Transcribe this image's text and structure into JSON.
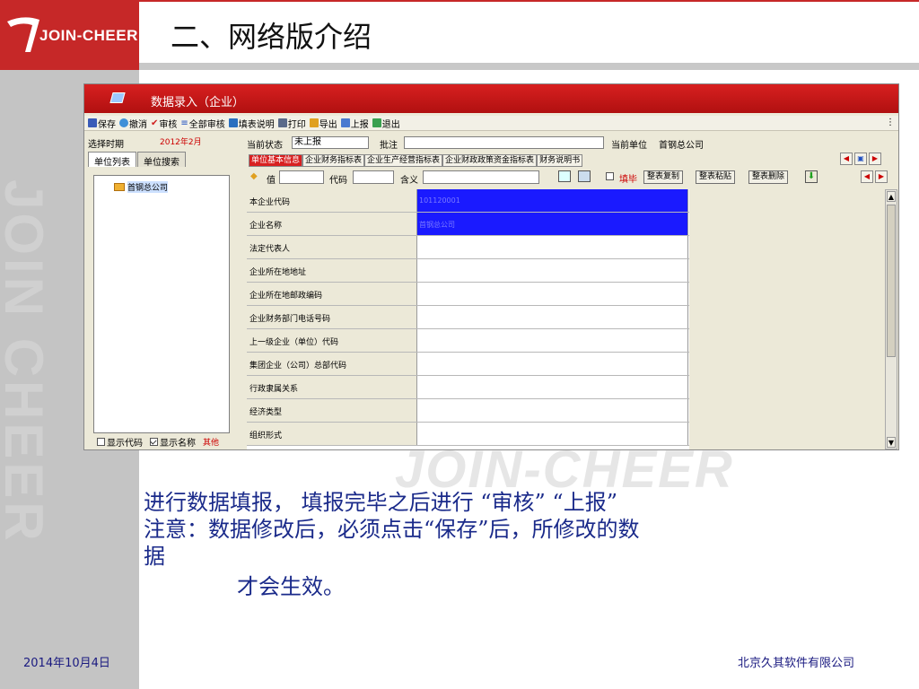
{
  "logo": {
    "text": "JOIN-CHEER"
  },
  "slide": {
    "title": "二、网络版介绍"
  },
  "watermark": {
    "vertical": "JOIN CHEER",
    "horizontal": "JOIN-CHEER"
  },
  "window": {
    "title": "数据录入（企业）"
  },
  "toolbar": {
    "items": [
      "保存",
      "撤消",
      "审核",
      "全部审核",
      "填表说明",
      "打印",
      "导出",
      "上报",
      "退出"
    ],
    "more": "⋮"
  },
  "left_panel": {
    "period_label": "选择时期",
    "period_value": "2012年2月",
    "tabs": [
      "单位列表",
      "单位搜索"
    ],
    "tree_node": "首钢总公司",
    "show_code": "显示代码",
    "show_name": "显示名称",
    "other": "其他"
  },
  "status_row": {
    "status_label": "当前状态",
    "status_value": "未上报",
    "note_label": "批注",
    "note_value": "",
    "unit_label": "当前单位",
    "unit_value": "首钢总公司"
  },
  "report_tabs": [
    "单位基本信息",
    "企业财务指标表",
    "企业生产经营指标表",
    "企业财政政策资金指标表",
    "财务说明书"
  ],
  "filter_row": {
    "value_label": "值",
    "code_label": "代码",
    "meaning_label": "含义",
    "finish_label": "填毕",
    "copy_btn": "整表复制",
    "paste_btn": "整表粘贴",
    "delete_btn": "整表删除"
  },
  "grid": {
    "rows": [
      {
        "label": "本企业代码",
        "value": "101120001"
      },
      {
        "label": "企业名称",
        "value": "首钢总公司"
      },
      {
        "label": "法定代表人",
        "value": ""
      },
      {
        "label": "企业所在地地址",
        "value": ""
      },
      {
        "label": "企业所在地邮政编码",
        "value": ""
      },
      {
        "label": "企业财务部门电话号码",
        "value": ""
      },
      {
        "label": "上一级企业（单位）代码",
        "value": ""
      },
      {
        "label": "集团企业（公司）总部代码",
        "value": ""
      },
      {
        "label": "行政隶属关系",
        "value": ""
      },
      {
        "label": "经济类型",
        "value": ""
      },
      {
        "label": "组织形式",
        "value": ""
      }
    ]
  },
  "body_text": {
    "line1": "进行数据填报， 填报完毕之后进行 “审核” “上报”",
    "line2": "注意：数据修改后，必须点击“保存”后，所修改的数",
    "line3": "据",
    "line4": "才会生效。"
  },
  "footer": {
    "date": "2014年10月4日",
    "company": "北京久其软件有限公司"
  },
  "colors": {
    "brand_red": "#c62828",
    "selection_blue": "#1a1aff",
    "text_blue": "#1a2a8a"
  }
}
